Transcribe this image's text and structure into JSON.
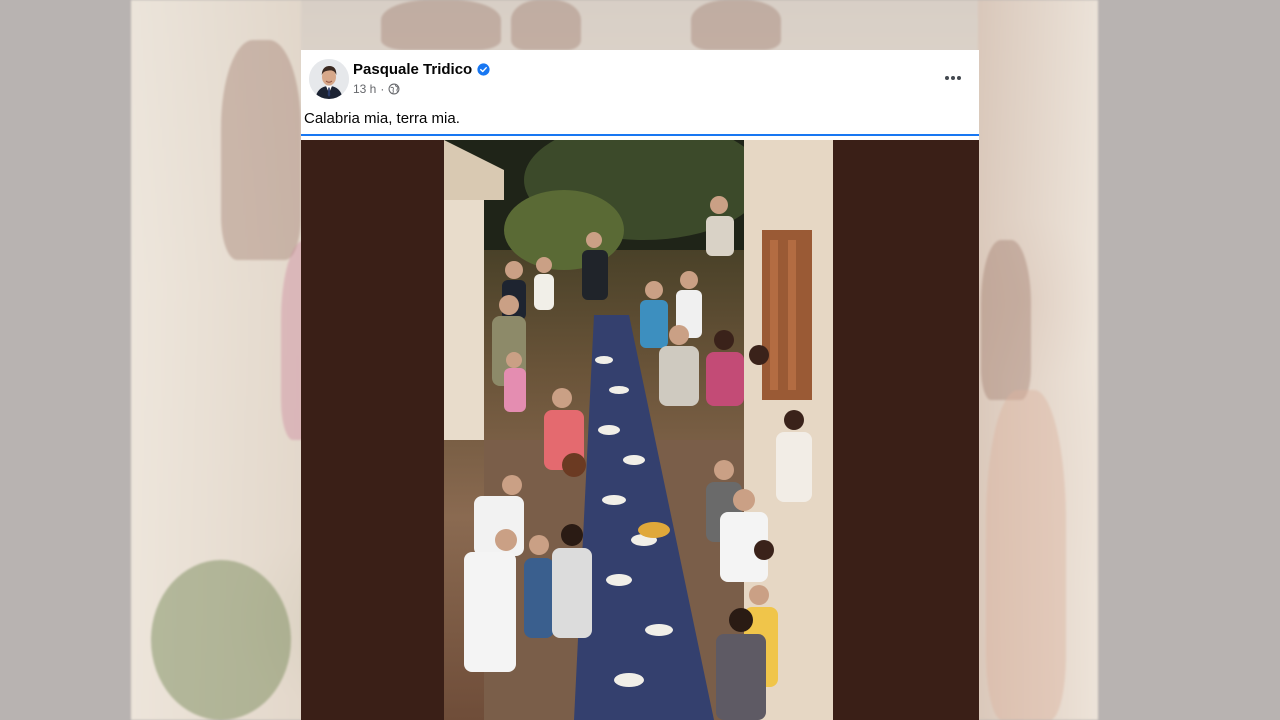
{
  "post": {
    "author": "Pasquale Tridico",
    "verified": true,
    "time": "13 h",
    "separator": "·",
    "audience_icon": "globe-icon",
    "text": "Calabria mia, terra mia.",
    "more_icon": "more-dots-icon"
  },
  "photo": {
    "description_icon": "photo",
    "background_color": "#3a1f17"
  },
  "colors": {
    "accent": "#1877f2",
    "verified": "#1877f2",
    "text": "#050505",
    "meta": "#65676b"
  }
}
